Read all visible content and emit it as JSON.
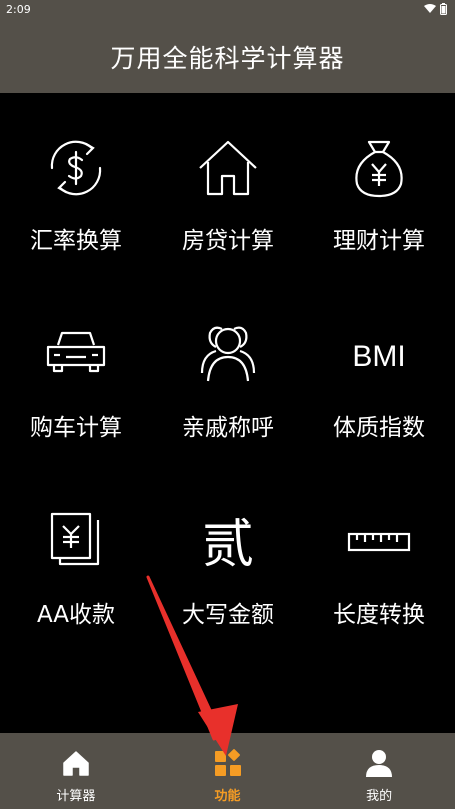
{
  "status": {
    "time": "2:09"
  },
  "header": {
    "title": "万用全能科学计算器"
  },
  "grid": {
    "items": [
      {
        "label": "汇率换算",
        "icon": "currency-exchange-icon"
      },
      {
        "label": "房贷计算",
        "icon": "house-icon"
      },
      {
        "label": "理财计算",
        "icon": "money-bag-icon"
      },
      {
        "label": "购车计算",
        "icon": "car-icon"
      },
      {
        "label": "亲戚称呼",
        "icon": "people-icon"
      },
      {
        "label": "体质指数",
        "icon": "bmi-icon",
        "glyph": "BMI"
      },
      {
        "label": "AA收款",
        "icon": "yuan-note-icon"
      },
      {
        "label": "大写金额",
        "icon": "chinese-numeral-icon",
        "glyph": "贰"
      },
      {
        "label": "长度转换",
        "icon": "ruler-icon"
      }
    ]
  },
  "tabs": [
    {
      "label": "计算器",
      "icon": "home-icon",
      "active": false
    },
    {
      "label": "功能",
      "icon": "grid-icon",
      "active": true
    },
    {
      "label": "我的",
      "icon": "user-icon",
      "active": false
    }
  ],
  "colors": {
    "header_bg": "#545049",
    "accent": "#f59c24",
    "annotation_arrow": "#e8302b"
  }
}
